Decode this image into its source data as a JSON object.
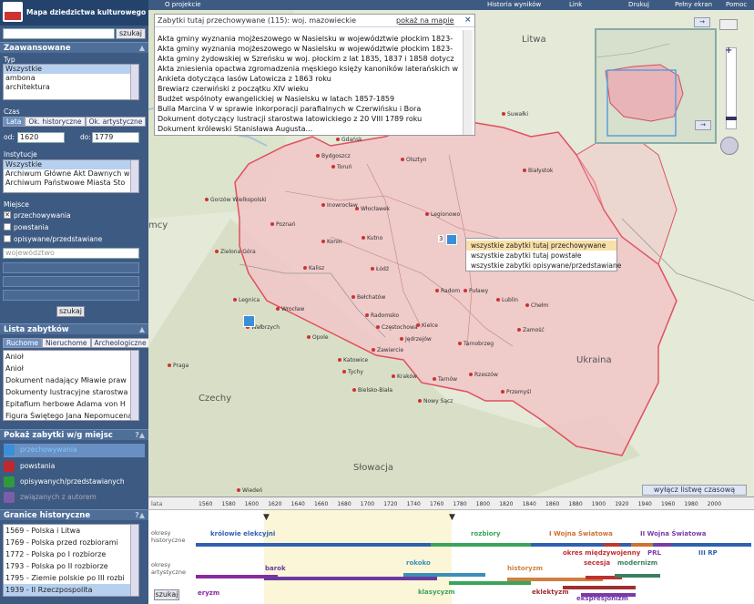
{
  "app": {
    "title": "Mapa dziedzictwa kulturowego Polski"
  },
  "search": {
    "button": "szukaj"
  },
  "advanced": {
    "header": "Zaawansowane",
    "type_label": "Typ",
    "types": [
      "Wszystkie",
      "ambona",
      "architektura"
    ],
    "time_label": "Czas",
    "time_tabs": [
      "Lata",
      "Ok. historyczne",
      "Ok. artystyczne"
    ],
    "from_label": "od:",
    "from_value": "1620",
    "to_label": "do:",
    "to_value": "1779",
    "inst_label": "Instytucje",
    "institutions": [
      "Wszystkie",
      "Archiwum Główne Akt Dawnych w",
      "Archiwum Państwowe Miasta Sto"
    ],
    "place_label": "Miejsce",
    "places": [
      {
        "label": "przechowywania",
        "checked": true
      },
      {
        "label": "powstania",
        "checked": false
      },
      {
        "label": "opisywane/przedstawiane",
        "checked": false
      }
    ],
    "voivodeship_placeholder": "województwo",
    "search_button": "szukaj"
  },
  "list": {
    "header": "Lista zabytków",
    "tabs": [
      "Ruchome",
      "Nieruchome",
      "Archeologiczne"
    ],
    "items": [
      "Anioł",
      "Anioł",
      "Dokument nadający Mławie praw",
      "Dokumenty lustracyjne starostwa",
      "Epitafium herbowe Adama von H",
      "Figura Świętego Jana Nepomucena"
    ]
  },
  "legend": {
    "header": "Pokaż zabytki w/g miejsc",
    "items": [
      {
        "label": "przechowywania",
        "color": "#3a8fd8",
        "active": true
      },
      {
        "label": "powstania",
        "color": "#c0282d",
        "active": false
      },
      {
        "label": "opisywanych/przedstawianych",
        "color": "#2e9a3c",
        "active": false
      },
      {
        "label": "związanych z autorem",
        "color": "#7a5fa8",
        "active": false
      }
    ]
  },
  "borders": {
    "header": "Granice historyczne",
    "items": [
      "1569 - Polska i Litwa",
      "1769 - Polska przed rozbiorami",
      "1772 - Polska po I rozbiorze",
      "1793 - Polska po II rozbiorze",
      "1795 - Ziemie polskie po III rozbi",
      "1939 - II Rzeczpospolita"
    ],
    "selected": 5
  },
  "toolbar": {
    "about": "O projekcie",
    "history": "Historia wyników",
    "link": "Link",
    "print": "Drukuj",
    "fullscreen": "Pełny ekran",
    "help": "Pomoc"
  },
  "popup": {
    "title": "Zabytki tutaj przechowywane (115): woj. mazowieckie",
    "show_on_map": "pokaż na mapie",
    "rows": [
      "Akta gminy wyznania mojżeszowego w Nasielsku w województwie płockim 1823-",
      "Akta gminy wyznania mojżeszowego w Nasielsku w województwie płockim 1823-",
      "Akta gminy żydowskiej w Szreńsku w woj. płockim z lat 1835, 1837 i 1858 dotycz",
      "Akta zniesienia opactwa zgromadzenia męskiego księży kanoników laterańskich w",
      "Ankieta dotycząca lasów Latowicza z 1863 roku",
      "Brewiarz czerwiński z początku XIV wieku",
      "Budżet wspólnoty ewangelickiej w Nasielsku w latach 1857-1859",
      "Bulla Marcina V w sprawie inkorporacji parafialnych w Czerwińsku i Bora",
      "Dokument dotyczący lustracji starostwa latowickiego z 20 VIII 1789 roku",
      "Dokument królewski Stanisława Augusta..."
    ]
  },
  "context_menu": {
    "items": [
      "wszystkie zabytki tutaj przechowywane",
      "wszystkie zabytki tutaj powstałe",
      "wszystkie zabytki opisywane/przedstawiane"
    ]
  },
  "map": {
    "countries": [
      {
        "name": "Litwa"
      },
      {
        "name": "Ukraina"
      },
      {
        "name": "Czechy"
      },
      {
        "name": "Słowacja"
      },
      {
        "name": "mcy"
      }
    ],
    "cities": [
      "Suwałki",
      "Gdańsk",
      "Białystok",
      "Bydgoszcz",
      "Toruń",
      "Olsztyn",
      "Gorzów Wielkopolski",
      "Inowrocław",
      "Włocławek",
      "Legionowo",
      "Poznań",
      "Konin",
      "Kutno",
      "Zielona Góra",
      "Kalisz",
      "Łódź",
      "Lublin",
      "Radom",
      "Puławy",
      "Bełchatów",
      "Chełm",
      "Legnica",
      "Wrocław",
      "Radomsko",
      "Częstochowa",
      "Kielce",
      "Zamość",
      "Opole",
      "Jędrzejów",
      "Tarnobrzeg",
      "Zawiercie",
      "Katowice",
      "Tychy",
      "Kraków",
      "Tarnów",
      "Rzeszów",
      "Bielsko-Biała",
      "Nowy Sącz",
      "Przemyśl",
      "Wałbrzych",
      "Praga",
      "Wiedeń"
    ],
    "marker_count": "3"
  },
  "timeline": {
    "toggle_button": "wyłącz listwę czasową",
    "row_labels": [
      "lata",
      "okresy historyczne",
      "okresy artystyczne"
    ],
    "years": [
      "1560",
      "1580",
      "1600",
      "1620",
      "1640",
      "1660",
      "1680",
      "1700",
      "1720",
      "1740",
      "1760",
      "1780",
      "1800",
      "1820",
      "1840",
      "1860",
      "1880",
      "1900",
      "1920",
      "1940",
      "1960",
      "1980",
      "2000"
    ],
    "range": [
      1620,
      1779
    ],
    "historical": [
      "królowie elekcyjni",
      "rozbiory",
      "I Wojna Światowa",
      "II Wojna Światowa",
      "okres międzywojenny",
      "PRL",
      "III RP"
    ],
    "artistic": [
      "barok",
      "rokoko",
      "historyzm",
      "secesja",
      "modernizm",
      "klasycyzm",
      "eklektyzm",
      "ekspresjonizm",
      "eryzm"
    ],
    "search_button": "szukaj"
  }
}
